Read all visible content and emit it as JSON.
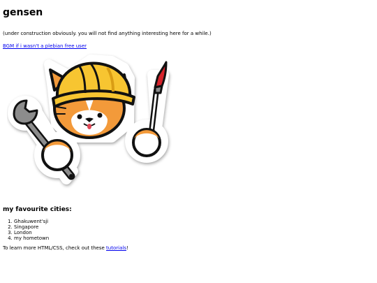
{
  "header": {
    "title": "gensen",
    "subtitle": "(under construction obviously. you will not find anything interesting here for a while.)",
    "bgm_link": "BGM if i wasn't a plebian free user"
  },
  "illustration": {
    "icon": "cat-builder-icon",
    "colors": {
      "helmet": "#f7c531",
      "fur": "#f39a3a",
      "outline": "#111111",
      "wrench": "#777777",
      "brush_tip": "#d6232b"
    }
  },
  "cities": {
    "heading": "my favourite cities:",
    "items": [
      "Ghakuwent'sji",
      "Singapore",
      "London",
      "my hometown"
    ]
  },
  "footer": {
    "prefix": "To learn more HTML/CSS, check out these ",
    "link": "tutorials",
    "suffix": "!"
  }
}
